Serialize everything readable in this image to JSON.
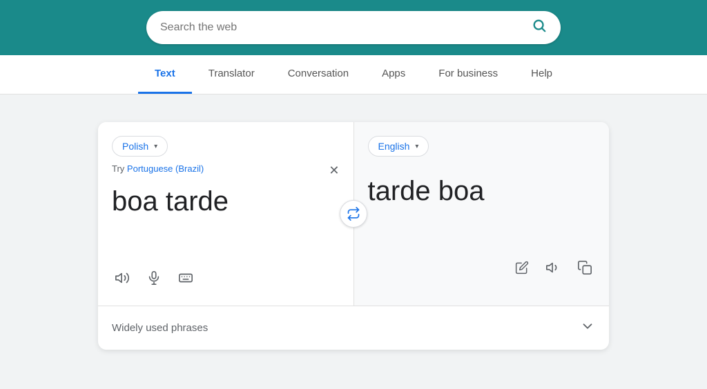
{
  "header": {
    "search_placeholder": "Search the web",
    "search_icon": "search-icon",
    "bg_color": "#1a8a8a"
  },
  "nav": {
    "items": [
      {
        "label": "Text",
        "active": true
      },
      {
        "label": "Translator",
        "active": false
      },
      {
        "label": "Conversation",
        "active": false
      },
      {
        "label": "Apps",
        "active": false
      },
      {
        "label": "For business",
        "active": false
      },
      {
        "label": "Help",
        "active": false
      }
    ]
  },
  "translator": {
    "source_language": "Polish",
    "target_language": "English",
    "suggestion_text": "Try",
    "suggestion_link": "Portuguese (Brazil)",
    "source_text": "boa tarde",
    "target_text": "tarde boa",
    "phrases_label": "Widely used phrases",
    "icons": {
      "volume": "volume-icon",
      "mic": "mic-icon",
      "keyboard": "keyboard-icon",
      "edit": "edit-icon",
      "volume_out": "volume-out-icon",
      "copy": "copy-icon",
      "swap": "swap-icon",
      "close": "close-icon",
      "chevron_down": "chevron-down-icon"
    }
  }
}
